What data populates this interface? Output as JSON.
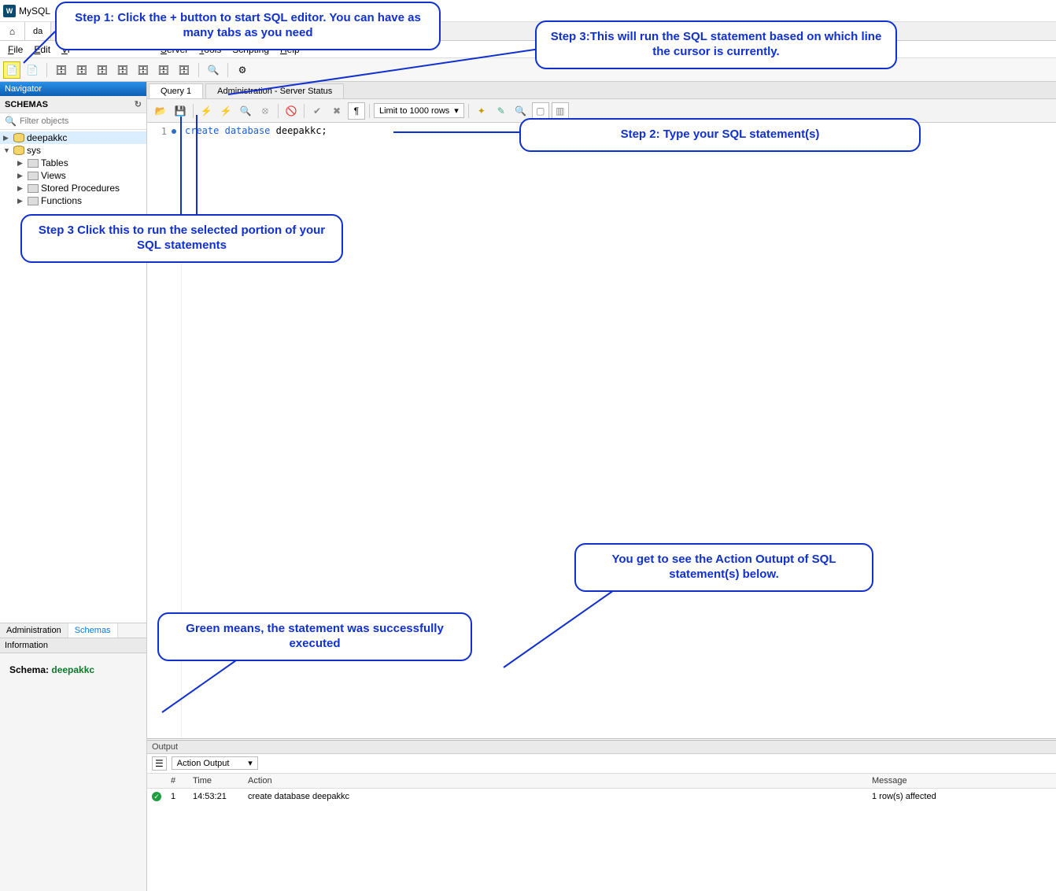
{
  "titlebar": {
    "app_name": "MySQL"
  },
  "tabs": {
    "connection": "da"
  },
  "menu": {
    "file": "File",
    "edit": "Edit",
    "view": "View",
    "server": "Server",
    "tools": "Tools",
    "scripting": "Scripting",
    "help": "Help"
  },
  "sidebar": {
    "navigator": "Navigator",
    "schemas": "SCHEMAS",
    "filter_placeholder": "Filter objects",
    "tree": {
      "db1": "deepakkc",
      "db2": "sys",
      "tables": "Tables",
      "views": "Views",
      "sp": "Stored Procedures",
      "functions": "Functions"
    },
    "bottom_tabs": {
      "admin": "Administration",
      "schemas": "Schemas"
    },
    "info_header": "Information",
    "info_label": "Schema:",
    "info_value": "deepakkc"
  },
  "editor": {
    "tabs": {
      "query1": "Query 1",
      "admin": "Administration - Server Status"
    },
    "row_limit": "Limit to 1000 rows",
    "line_no": "1",
    "code_kw1": "create",
    "code_kw2": "database",
    "code_rest": " deepakkc;"
  },
  "output": {
    "header": "Output",
    "selector": "Action Output",
    "columns": {
      "num": "#",
      "time": "Time",
      "action": "Action",
      "message": "Message"
    },
    "row": {
      "num": "1",
      "time": "14:53:21",
      "action": "create database deepakkc",
      "message": "1 row(s) affected"
    }
  },
  "callouts": {
    "step1": "Step 1: Click the + button to start SQL editor. You can have as many tabs as you need",
    "step2": "Step 2: Type your SQL statement(s)",
    "step3a": "Step 3:This will run the SQL statement based on which line the cursor is currently.",
    "step3b": "Step 3 Click this to run the selected portion of your SQL statements",
    "out1": "You get to see the Action Outupt of SQL statement(s) below.",
    "green": "Green means, the statement was successfully executed"
  }
}
